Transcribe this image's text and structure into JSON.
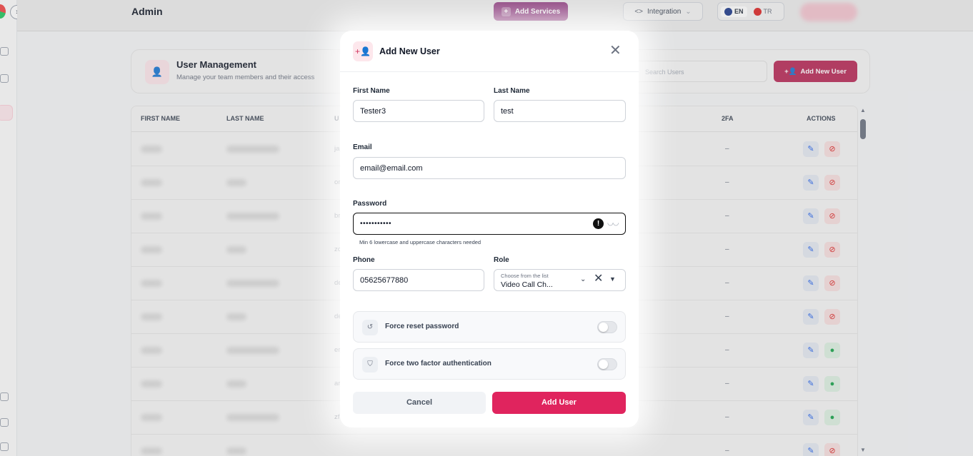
{
  "header": {
    "title": "Admin",
    "add_services_label": "Add Services",
    "integration_label": "Integration",
    "lang_en": "EN",
    "lang_tr": "TR"
  },
  "user_management": {
    "title": "User Management",
    "subtitle": "Manage your team members and their access",
    "search_placeholder": "Search Users",
    "add_new_user_label": "Add New User"
  },
  "table": {
    "columns": [
      "FIRST NAME",
      "LAST NAME",
      "U",
      "2FA",
      "ACTIONS"
    ],
    "rows": [
      {
        "frag": "ja",
        "twofa": "–",
        "status": "blocked"
      },
      {
        "frag": "or",
        "twofa": "–",
        "status": "blocked"
      },
      {
        "frag": "br",
        "twofa": "–",
        "status": "blocked"
      },
      {
        "frag": "zc",
        "twofa": "–",
        "status": "blocked"
      },
      {
        "frag": "de",
        "twofa": "–",
        "status": "blocked"
      },
      {
        "frag": "de",
        "twofa": "–",
        "status": "blocked"
      },
      {
        "frag": "er",
        "twofa": "–",
        "status": "active"
      },
      {
        "frag": "ar",
        "twofa": "–",
        "status": "active"
      },
      {
        "frag": "zf",
        "twofa": "–",
        "status": "active"
      },
      {
        "frag": "",
        "twofa": "–",
        "status": "blocked"
      }
    ]
  },
  "modal": {
    "title": "Add New User",
    "first_name_label": "First Name",
    "first_name_value": "Tester3",
    "last_name_label": "Last Name",
    "last_name_value": "test",
    "email_label": "Email",
    "email_value": "email@email.com",
    "password_label": "Password",
    "password_value": "•••••••••••",
    "password_hint": "Min 6 lowercase and uppercase characters needed",
    "phone_label": "Phone",
    "phone_value": "05625677880",
    "role_label": "Role",
    "role_placeholder": "Choose from the list",
    "role_value": "Video Call Ch...",
    "force_reset_label": "Force reset password",
    "force_2fa_label": "Force two factor authentication",
    "cancel_label": "Cancel",
    "submit_label": "Add User"
  },
  "colors": {
    "brand": "#e0245e",
    "brand_dark": "#b82a57",
    "services": "#8b2f7a"
  }
}
